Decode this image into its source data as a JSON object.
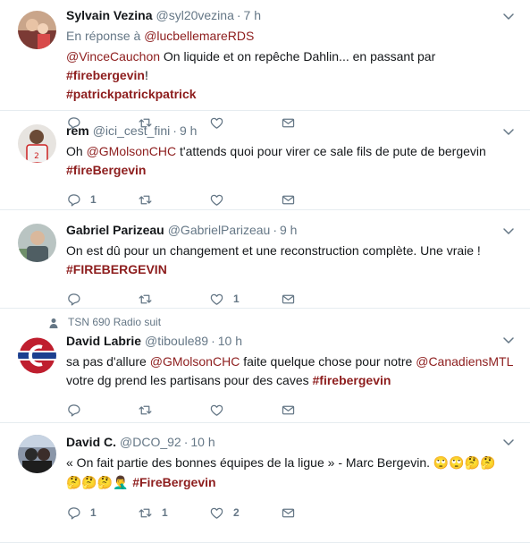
{
  "tweets": [
    {
      "name": "Sylvain Vezina",
      "handle": "@syl20vezina",
      "time": "7 h",
      "reply_prefix": "En réponse à",
      "reply_to": "@lucbellemareRDS",
      "mention": "@VinceCauchon",
      "text_a": " On liquide et on repêche Dahlin... en passant par ",
      "hashtag1": "#firebergevin",
      "text_b": "!",
      "hashtag2": "#patrickpatrickpatrick",
      "replies": "",
      "retweets": "",
      "likes": ""
    },
    {
      "name": "rem",
      "handle": "@ici_cest_fini",
      "time": "9 h",
      "text_pre": "Oh ",
      "mention": "@GMolsonCHC",
      "text_a": " t'attends quoi pour virer ce sale fils de pute de bergevin",
      "hashtag1": "#fireBergevin",
      "replies": "1",
      "retweets": "",
      "likes": ""
    },
    {
      "name": "Gabriel Parizeau",
      "handle": "@GabrielParizeau",
      "time": "9 h",
      "text_a": "On est dû pour un changement et une reconstruction complète. Une vraie !",
      "hashtag1": "#FIREBERGEVIN",
      "replies": "",
      "retweets": "",
      "likes": "1"
    },
    {
      "retweeter": "TSN 690 Radio suit",
      "name": "David Labrie",
      "handle": "@tiboule89",
      "time": "10 h",
      "text_pre": "sa pas d'allure ",
      "mention": "@GMolsonCHC",
      "text_a": " faite quelque chose pour notre ",
      "mention2": "@CanadiensMTL",
      "text_b": "votre dg prend les partisans pour des caves ",
      "hashtag1": "#firebergevin",
      "replies": "",
      "retweets": "",
      "likes": ""
    },
    {
      "name": "David C.",
      "handle": "@DCO_92",
      "time": "10 h",
      "text_a": "« On fait partie des bonnes équipes de la ligue » - Marc Bergevin. ",
      "emojis1": "🙄🙄🤔🤔",
      "emojis2": "🤔🤔🤔🤦‍♂️ ",
      "hashtag1": "#FireBergevin",
      "replies": "1",
      "retweets": "1",
      "likes": "2"
    }
  ],
  "colors": {
    "link": "#8d1d1d",
    "muted": "#657786",
    "divider": "#e6ecf0"
  },
  "icons": [
    "chevron-down-icon",
    "reply-icon",
    "retweet-icon",
    "like-icon",
    "dm-icon"
  ]
}
